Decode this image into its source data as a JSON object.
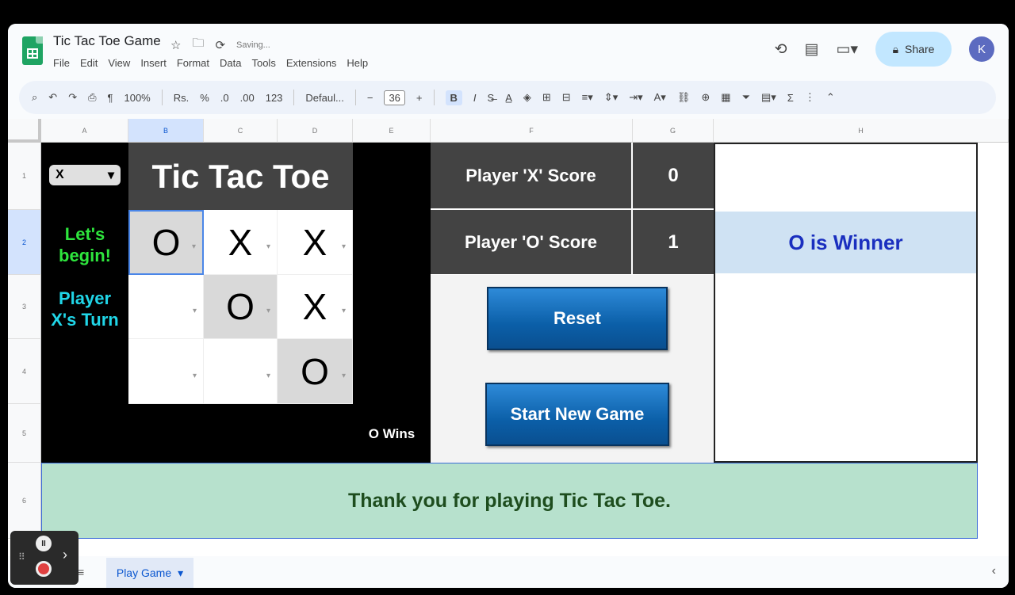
{
  "app": {
    "doc_title": "Tic Tac Toe Game",
    "saving_status": "Saving...",
    "menu": [
      "File",
      "Edit",
      "View",
      "Insert",
      "Format",
      "Data",
      "Tools",
      "Extensions",
      "Help"
    ],
    "share_label": "Share",
    "avatar_initial": "K"
  },
  "toolbar": {
    "zoom": "100%",
    "currency": "Rs.",
    "percent": "%",
    "decimal_dec": ".0",
    "decimal_inc": ".00",
    "number_format": "123",
    "font": "Defaul...",
    "font_size": "36",
    "bold": "B",
    "italic": "I"
  },
  "columns": [
    "A",
    "B",
    "C",
    "D",
    "E",
    "F",
    "G",
    "H"
  ],
  "rows": [
    "1",
    "2",
    "3",
    "4",
    "5",
    "6"
  ],
  "game": {
    "player_select": "X",
    "title": "Tic Tac Toe",
    "status_line1": "Let's",
    "status_line2": "begin!",
    "turn_line1": "Player",
    "turn_line2": "X's Turn",
    "board": [
      [
        "O",
        "X",
        "X"
      ],
      [
        "",
        "O",
        "X"
      ],
      [
        "",
        "",
        "O"
      ]
    ],
    "result_text": "O Wins",
    "score_x_label": "Player 'X' Score",
    "score_x_value": "0",
    "score_o_label": "Player 'O' Score",
    "score_o_value": "1",
    "winner_text": "O is Winner",
    "reset_label": "Reset",
    "new_game_label": "Start New Game",
    "thanks_text": "Thank you for playing Tic Tac Toe."
  },
  "sheet_tab": "Play Game"
}
